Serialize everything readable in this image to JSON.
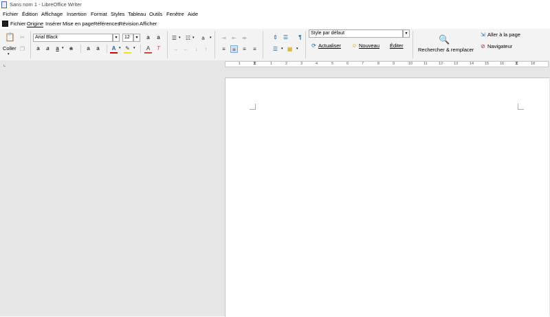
{
  "window": {
    "title": "Sans nom 1 - LibreOffice Writer"
  },
  "menubar": [
    "Fichier",
    "Édition",
    "Affichage",
    "Insertion",
    "Format",
    "Styles",
    "Tableau",
    "Outils",
    "Fenêtre",
    "Aide"
  ],
  "tabs": [
    "Fichier",
    "Origine",
    "Insérer",
    "Mise en page",
    "Références",
    "Révision",
    "Afficher"
  ],
  "ribbon": {
    "paste_label": "Coller",
    "font_name": "Arial Black",
    "font_size": "12",
    "paragraph_style": "Style par défaut",
    "update_label": "Actualiser",
    "new_label": "Nouveau",
    "edit_label": "Éditer",
    "find_replace_label": "Rechercher & remplacer",
    "goto_page_label": "Aller à la page",
    "navigator_label": "Navigateur"
  },
  "ruler": {
    "numbers": [
      "1",
      "1",
      "2",
      "3",
      "4",
      "5",
      "6",
      "7",
      "8",
      "9",
      "10",
      "11",
      "12",
      "13",
      "14",
      "15",
      "16",
      "17",
      "18"
    ]
  },
  "colors": {
    "accent": "#1d5fa8",
    "workspace": "#e6e6e6",
    "ribbon": "#f3f3f3"
  }
}
